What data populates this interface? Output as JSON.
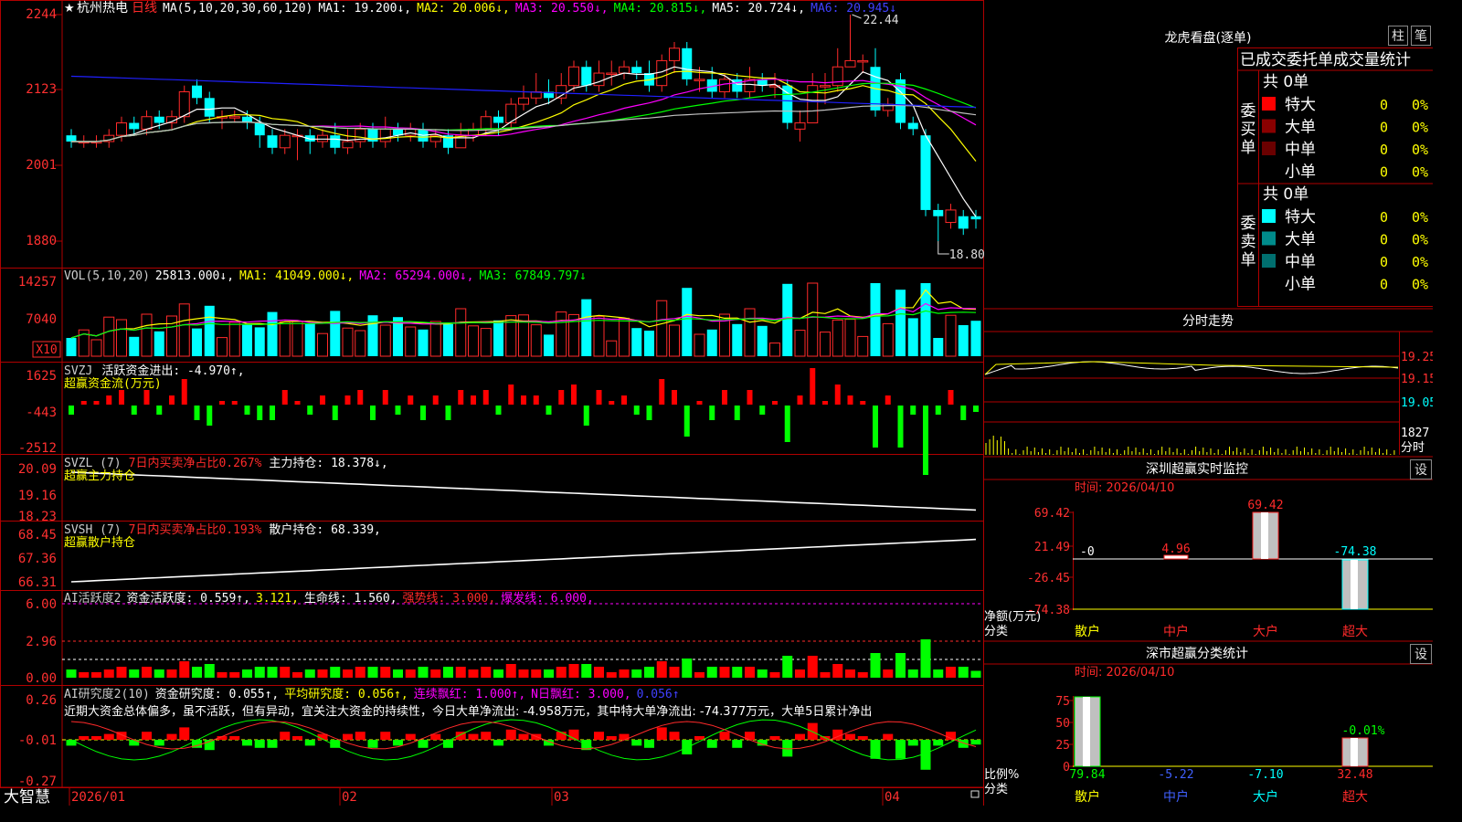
{
  "colors": {
    "up": "#ff2a2a",
    "down": "#00ffff",
    "grid": "#b00000",
    "text": "#ffffff",
    "ma1": "#ffffff",
    "ma2": "#ffff00",
    "ma3": "#ff00ff",
    "ma4": "#00ff00",
    "ma5": "#c0c0c0",
    "ma6": "#2020ff"
  },
  "main": {
    "star": "★",
    "name": "杭州热电",
    "period": "日线",
    "legend": [
      {
        "text": "MA(5,10,20,30,60,120)",
        "color": "#ffffff"
      },
      {
        "text": "MA1: 19.200↓,",
        "color": "#ffffff"
      },
      {
        "text": "MA2: 20.006↓,",
        "color": "#ffff00"
      },
      {
        "text": "MA3: 20.550↓,",
        "color": "#ff00ff"
      },
      {
        "text": "MA4: 20.815↓,",
        "color": "#00ff00"
      },
      {
        "text": "MA5: 20.724↓,",
        "color": "#ffffff"
      },
      {
        "text": "MA6: 20.945↓",
        "color": "#4040ff"
      }
    ],
    "yticks": [
      "2244",
      "2123",
      "2001",
      "1880"
    ],
    "high_label": "22.44",
    "low_label": "18.80"
  },
  "vol": {
    "legend": [
      {
        "text": "VOL(5,10,20)",
        "color": "#cccccc"
      },
      {
        "text": "25813.000↓,",
        "color": "#ffffff"
      },
      {
        "text": "MA1: 41049.000↓,",
        "color": "#ffff00"
      },
      {
        "text": "MA2: 65294.000↓,",
        "color": "#ff00ff"
      },
      {
        "text": "MA3: 67849.797↓",
        "color": "#00ff00"
      }
    ],
    "yticks": [
      "14257",
      "7040"
    ],
    "unit": "X10"
  },
  "svzj": {
    "line1": [
      {
        "text": "SVZJ",
        "color": "#cccccc"
      },
      {
        "text": "活跃资金进出: -4.970↑,",
        "color": "#ffffff"
      }
    ],
    "line2": {
      "text": "超赢资金流(万元)",
      "color": "#ffff00"
    },
    "yticks": [
      "1625",
      "-443",
      "-2512"
    ]
  },
  "svzl": {
    "line1": [
      {
        "text": "SVZL (7)",
        "color": "#cccccc"
      },
      {
        "text": "7日内买卖净占比0.267%",
        "color": "#ff2a2a"
      },
      {
        "text": "主力持仓: 18.378↓,",
        "color": "#ffffff"
      }
    ],
    "line2": {
      "text": "超赢主力持仓",
      "color": "#ffff00"
    },
    "yticks": [
      "20.09",
      "19.16",
      "18.23"
    ]
  },
  "svsh": {
    "line1": [
      {
        "text": "SVSH (7)",
        "color": "#cccccc"
      },
      {
        "text": "7日内买卖净占比0.193%",
        "color": "#ff2a2a"
      },
      {
        "text": "散户持仓: 68.339,",
        "color": "#ffffff"
      }
    ],
    "line2": {
      "text": "超赢散户持仓",
      "color": "#ffff00"
    },
    "yticks": [
      "68.45",
      "67.36",
      "66.31"
    ]
  },
  "ai2": {
    "line": [
      {
        "text": "AI活跃度2",
        "color": "#cccccc"
      },
      {
        "text": "资金活跃度: 0.559↑,",
        "color": "#ffffff"
      },
      {
        "text": "3.121,",
        "color": "#ffff00"
      },
      {
        "text": "生命线: 1.560,",
        "color": "#ffffff"
      },
      {
        "text": "强势线: 3.000,",
        "color": "#ff2a2a"
      },
      {
        "text": "爆发线: 6.000,",
        "color": "#ff00ff"
      }
    ],
    "yticks": [
      "6.00",
      "2.96",
      "0.00"
    ]
  },
  "ai_res": {
    "line": [
      {
        "text": "AI研究度2(10)",
        "color": "#cccccc"
      },
      {
        "text": "资金研究度: 0.055↑,",
        "color": "#ffffff"
      },
      {
        "text": "平均研究度: 0.056↑,",
        "color": "#ffff00"
      },
      {
        "text": "连续飘红: 1.000↑,",
        "color": "#ff00ff"
      },
      {
        "text": "N日飘红: 3.000,",
        "color": "#ff00ff"
      },
      {
        "text": "0.056↑",
        "color": "#4040ff"
      }
    ],
    "comment": "近期大资金总体偏多，虽不活跃，但有异动，宜关注大资金的持续性，今日大单净流出: -4.958万元，其中特大单净流出: -74.377万元，大单5日累计净出",
    "yticks": [
      "0.26",
      "-0.01",
      "-0.27"
    ]
  },
  "xaxis": {
    "labels": [
      "2026/01",
      "02",
      "03",
      "04"
    ]
  },
  "logo": "大智慧",
  "right": {
    "title": "龙虎看盘(逐单)",
    "btn_bar": "柱",
    "btn_pen": "笔",
    "header": "已成交委托单成交量统计",
    "buy_label": "委买单",
    "sell_label": "委卖单",
    "buy_total": "共 0单",
    "sell_total": "共 0单",
    "buy_rows": [
      {
        "name": "特大",
        "val": "0",
        "pct": "0%",
        "color": "#ff0000"
      },
      {
        "name": "大单",
        "val": "0",
        "pct": "0%",
        "color": "#8a0000"
      },
      {
        "name": "中单",
        "val": "0",
        "pct": "0%",
        "color": "#6a0000"
      },
      {
        "name": "小单",
        "val": "0",
        "pct": "0%",
        "color": "#000000"
      }
    ],
    "sell_rows": [
      {
        "name": "特大",
        "val": "0",
        "pct": "0%",
        "color": "#00ffff"
      },
      {
        "name": "大单",
        "val": "0",
        "pct": "0%",
        "color": "#008c8c"
      },
      {
        "name": "中单",
        "val": "0",
        "pct": "0%",
        "color": "#006f6f"
      },
      {
        "name": "小单",
        "val": "0",
        "pct": "0%",
        "color": "#000000"
      }
    ],
    "fenshi_title": "分时走势",
    "fenshi_y": [
      "19.25",
      "19.15",
      "19.05"
    ],
    "fenshi_vol": "1827",
    "fenshi_unit": "分时",
    "sz_title": "深圳超赢实时监控",
    "sz_set": "设",
    "sz_time": "时间: 2026/04/10",
    "sz_y": [
      "69.42",
      "21.49",
      "-26.45",
      "-74.38"
    ],
    "sz_vals": [
      {
        "text": "-0",
        "color": "#ffffff"
      },
      {
        "text": "4.96",
        "color": "#ff2a2a"
      },
      {
        "text": "69.42",
        "color": "#ff2a2a"
      },
      {
        "text": "-74.38",
        "color": "#00ffff"
      }
    ],
    "sz_axis_l1": "净额(万元)",
    "sz_axis_l2": "分类",
    "cats": [
      {
        "text": "散户",
        "color": "#ffff00"
      },
      {
        "text": "中户",
        "color": "#ff2a2a"
      },
      {
        "text": "大户",
        "color": "#ff2a2a"
      },
      {
        "text": "超大",
        "color": "#ff2a2a"
      }
    ],
    "fl_title": "深市超赢分类统计",
    "fl_set": "设",
    "fl_time": "时间: 2026/04/10",
    "fl_y": [
      "75",
      "50",
      "25",
      "0"
    ],
    "fl_top": "-0.01%",
    "fl_vals": [
      {
        "text": "79.84",
        "color": "#00ff00"
      },
      {
        "text": "-5.22",
        "color": "#4060ff"
      },
      {
        "text": "-7.10",
        "color": "#00ffff"
      },
      {
        "text": "32.48",
        "color": "#ff2a2a"
      }
    ],
    "fl_axis_l1": "比例%",
    "fl_axis_l2": "分类",
    "cats2": [
      {
        "text": "散户",
        "color": "#ffff00"
      },
      {
        "text": "中户",
        "color": "#4060ff"
      },
      {
        "text": "大户",
        "color": "#00ffff"
      },
      {
        "text": "超大",
        "color": "#ff2a2a"
      }
    ]
  },
  "chart_data": {
    "type": "candlestick",
    "price_range": [
      18.8,
      22.44
    ],
    "candles": [
      [
        20.5,
        20.4,
        20.6,
        20.3
      ],
      [
        20.4,
        20.4,
        20.5,
        20.3
      ],
      [
        20.4,
        20.4,
        20.5,
        20.3
      ],
      [
        20.4,
        20.5,
        20.6,
        20.3
      ],
      [
        20.5,
        20.7,
        20.8,
        20.4
      ],
      [
        20.7,
        20.6,
        20.8,
        20.5
      ],
      [
        20.6,
        20.8,
        20.9,
        20.5
      ],
      [
        20.8,
        20.7,
        20.9,
        20.6
      ],
      [
        20.7,
        20.8,
        20.9,
        20.6
      ],
      [
        20.8,
        21.2,
        21.3,
        20.7
      ],
      [
        21.3,
        21.1,
        21.4,
        21.0
      ],
      [
        21.1,
        20.8,
        21.2,
        20.7
      ],
      [
        20.8,
        20.8,
        20.9,
        20.6
      ],
      [
        20.8,
        20.8,
        20.9,
        20.7
      ],
      [
        20.8,
        20.7,
        20.9,
        20.6
      ],
      [
        20.7,
        20.5,
        20.8,
        20.3
      ],
      [
        20.5,
        20.3,
        20.6,
        20.2
      ],
      [
        20.3,
        20.5,
        20.6,
        20.2
      ],
      [
        20.5,
        20.5,
        20.6,
        20.1
      ],
      [
        20.5,
        20.4,
        20.6,
        20.2
      ],
      [
        20.4,
        20.5,
        20.6,
        20.3
      ],
      [
        20.5,
        20.3,
        20.7,
        20.2
      ],
      [
        20.3,
        20.4,
        20.6,
        20.2
      ],
      [
        20.4,
        20.6,
        20.7,
        20.3
      ],
      [
        20.6,
        20.4,
        20.7,
        20.3
      ],
      [
        20.4,
        20.6,
        20.8,
        20.3
      ],
      [
        20.6,
        20.5,
        20.7,
        20.4
      ],
      [
        20.5,
        20.6,
        20.7,
        20.4
      ],
      [
        20.6,
        20.4,
        20.7,
        20.3
      ],
      [
        20.4,
        20.5,
        20.6,
        20.3
      ],
      [
        20.5,
        20.3,
        20.6,
        20.2
      ],
      [
        20.3,
        20.5,
        20.7,
        20.3
      ],
      [
        20.5,
        20.6,
        20.7,
        20.4
      ],
      [
        20.6,
        20.8,
        20.9,
        20.5
      ],
      [
        20.8,
        20.7,
        20.9,
        20.5
      ],
      [
        20.7,
        21.0,
        21.1,
        20.6
      ],
      [
        21.0,
        21.1,
        21.3,
        20.9
      ],
      [
        21.1,
        21.2,
        21.5,
        21.0
      ],
      [
        21.2,
        21.1,
        21.4,
        21.0
      ],
      [
        21.1,
        21.3,
        21.5,
        21.0
      ],
      [
        21.3,
        21.6,
        21.7,
        21.2
      ],
      [
        21.6,
        21.3,
        21.7,
        21.2
      ],
      [
        21.3,
        21.5,
        21.7,
        21.2
      ],
      [
        21.5,
        21.5,
        21.7,
        21.3
      ],
      [
        21.5,
        21.6,
        21.7,
        21.4
      ],
      [
        21.6,
        21.5,
        21.7,
        21.4
      ],
      [
        21.5,
        21.3,
        21.7,
        21.2
      ],
      [
        21.3,
        21.7,
        21.8,
        21.2
      ],
      [
        21.7,
        21.9,
        22.0,
        21.5
      ],
      [
        21.9,
        21.4,
        22.0,
        21.3
      ],
      [
        21.4,
        21.4,
        21.6,
        21.2
      ],
      [
        21.4,
        21.2,
        21.6,
        21.1
      ],
      [
        21.2,
        21.4,
        21.5,
        21.1
      ],
      [
        21.4,
        21.2,
        21.5,
        21.1
      ],
      [
        21.2,
        21.4,
        21.6,
        21.1
      ],
      [
        21.4,
        21.3,
        21.5,
        21.2
      ],
      [
        21.3,
        21.3,
        21.5,
        21.1
      ],
      [
        21.3,
        20.7,
        21.4,
        20.6
      ],
      [
        20.6,
        20.7,
        20.9,
        20.4
      ],
      [
        20.7,
        21.3,
        21.5,
        20.7
      ],
      [
        21.3,
        21.3,
        21.5,
        21.0
      ],
      [
        21.3,
        21.6,
        21.9,
        21.2
      ],
      [
        21.6,
        21.7,
        22.44,
        21.6
      ],
      [
        21.7,
        21.7,
        21.8,
        21.5
      ],
      [
        21.6,
        20.9,
        21.9,
        20.8
      ],
      [
        20.9,
        21.0,
        21.1,
        20.8
      ],
      [
        21.4,
        20.7,
        21.5,
        20.6
      ],
      [
        20.7,
        20.6,
        20.8,
        20.5
      ],
      [
        20.5,
        19.3,
        20.6,
        19.2
      ],
      [
        19.3,
        19.2,
        19.4,
        18.8
      ],
      [
        19.1,
        19.3,
        19.4,
        19.0
      ],
      [
        19.2,
        19.0,
        19.3,
        18.9
      ],
      [
        19.2,
        19.15,
        19.3,
        19.0
      ]
    ]
  }
}
